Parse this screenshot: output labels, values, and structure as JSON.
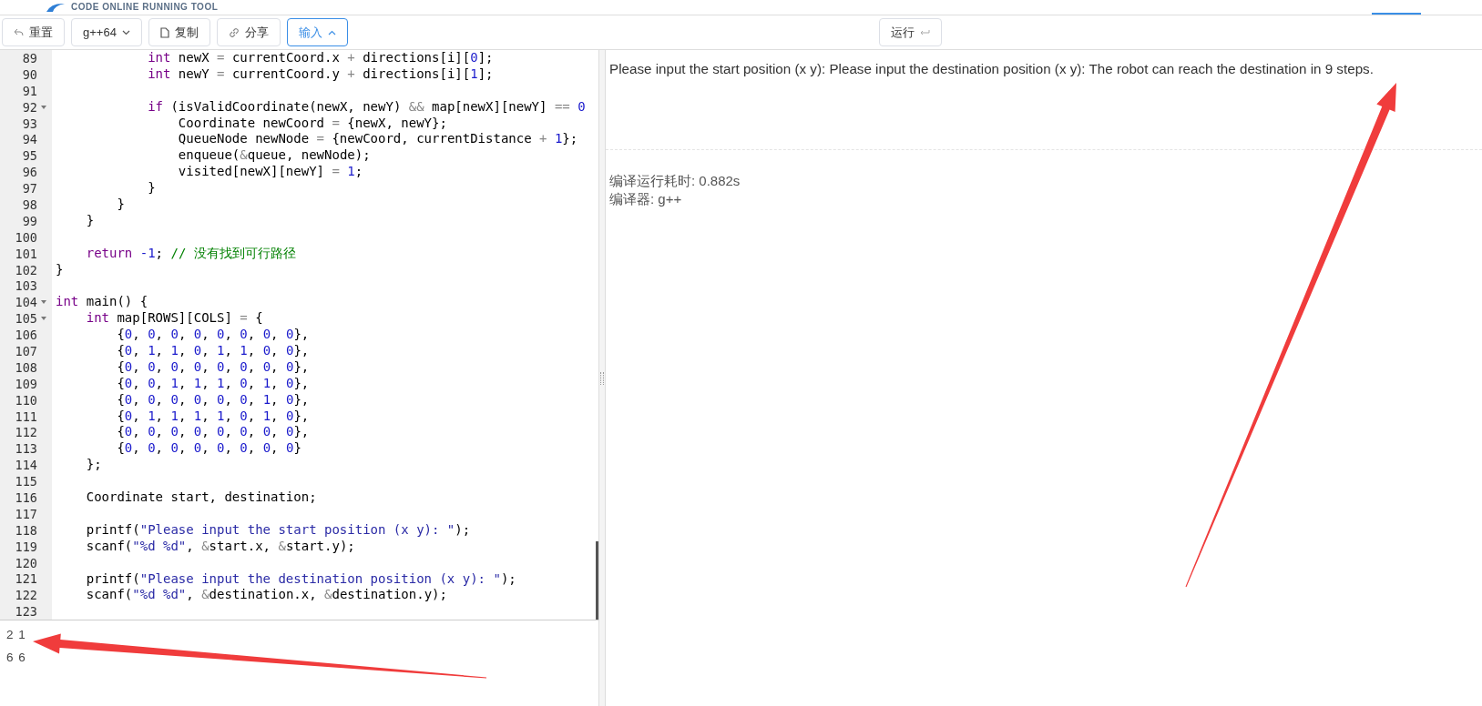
{
  "header": {
    "logo_text": "CODE ONLINE RUNNING TOOL"
  },
  "toolbar": {
    "buttons": [
      {
        "kind": "reset",
        "label": "重置",
        "selected": false
      },
      {
        "kind": "compiler",
        "label": "g++64",
        "selected": false
      },
      {
        "kind": "copy",
        "label": "复制",
        "selected": false
      },
      {
        "kind": "share",
        "label": "分享",
        "selected": false
      },
      {
        "kind": "input",
        "label": "输入",
        "selected": true
      }
    ],
    "run_button": {
      "label": "运行"
    }
  },
  "editor": {
    "lines": [
      {
        "number": "89",
        "fold": false,
        "tokens": [
          {
            "kind": "keyword",
            "text": "            int"
          },
          {
            "kind": "plain",
            "text": " newX "
          },
          {
            "kind": "operator",
            "text": "="
          },
          {
            "kind": "plain",
            "text": " currentCoord.x "
          },
          {
            "kind": "operator",
            "text": "+"
          },
          {
            "kind": "plain",
            "text": " directions[i]["
          },
          {
            "kind": "number",
            "text": "0"
          },
          {
            "kind": "plain",
            "text": "];"
          }
        ]
      },
      {
        "number": "90",
        "fold": false,
        "tokens": [
          {
            "kind": "keyword",
            "text": "            int"
          },
          {
            "kind": "plain",
            "text": " newY "
          },
          {
            "kind": "operator",
            "text": "="
          },
          {
            "kind": "plain",
            "text": " currentCoord.y "
          },
          {
            "kind": "operator",
            "text": "+"
          },
          {
            "kind": "plain",
            "text": " directions[i]["
          },
          {
            "kind": "number",
            "text": "1"
          },
          {
            "kind": "plain",
            "text": "];"
          }
        ]
      },
      {
        "number": "91",
        "fold": false
      },
      {
        "number": "92",
        "fold": true,
        "tokens": [
          {
            "kind": "keyword",
            "text": "            if"
          },
          {
            "kind": "plain",
            "text": " (isValidCoordinate(newX, newY) "
          },
          {
            "kind": "operator",
            "text": "&&"
          },
          {
            "kind": "plain",
            "text": " map[newX][newY] "
          },
          {
            "kind": "operator",
            "text": "== "
          },
          {
            "kind": "number",
            "text": "0"
          }
        ]
      },
      {
        "number": "93",
        "fold": false,
        "tokens": [
          {
            "kind": "plain",
            "text": "                Coordinate newCoord "
          },
          {
            "kind": "operator",
            "text": "="
          },
          {
            "kind": "plain",
            "text": " {newX, newY};"
          }
        ]
      },
      {
        "number": "94",
        "fold": false,
        "tokens": [
          {
            "kind": "plain",
            "text": "                QueueNode newNode "
          },
          {
            "kind": "operator",
            "text": "="
          },
          {
            "kind": "plain",
            "text": " {newCoord, currentDistance "
          },
          {
            "kind": "operator",
            "text": "+ "
          },
          {
            "kind": "number",
            "text": "1"
          },
          {
            "kind": "plain",
            "text": "};"
          }
        ]
      },
      {
        "number": "95",
        "fold": false,
        "tokens": [
          {
            "kind": "plain",
            "text": "                enqueue("
          },
          {
            "kind": "operator",
            "text": "&"
          },
          {
            "kind": "plain",
            "text": "queue, newNode);"
          }
        ]
      },
      {
        "number": "96",
        "fold": false,
        "tokens": [
          {
            "kind": "plain",
            "text": "                visited[newX][newY] "
          },
          {
            "kind": "operator",
            "text": "= "
          },
          {
            "kind": "number",
            "text": "1"
          },
          {
            "kind": "plain",
            "text": ";"
          }
        ]
      },
      {
        "number": "97",
        "fold": false,
        "tokens": [
          {
            "kind": "plain",
            "text": "            }"
          }
        ]
      },
      {
        "number": "98",
        "fold": false,
        "tokens": [
          {
            "kind": "plain",
            "text": "        }"
          }
        ]
      },
      {
        "number": "99",
        "fold": false,
        "tokens": [
          {
            "kind": "plain",
            "text": "    }"
          }
        ]
      },
      {
        "number": "100",
        "fold": false
      },
      {
        "number": "101",
        "fold": false,
        "tokens": [
          {
            "kind": "keyword",
            "text": "    return"
          },
          {
            "kind": "number",
            "text": " -1"
          },
          {
            "kind": "plain",
            "text": "; "
          },
          {
            "kind": "comment",
            "text": "// 没有找到可行路径"
          }
        ]
      },
      {
        "number": "102",
        "fold": false,
        "tokens": [
          {
            "kind": "plain",
            "text": "}"
          }
        ]
      },
      {
        "number": "103",
        "fold": false
      },
      {
        "number": "104",
        "fold": true,
        "tokens": [
          {
            "kind": "keyword",
            "text": "int"
          },
          {
            "kind": "plain",
            "text": " main() {"
          }
        ]
      },
      {
        "number": "105",
        "fold": true,
        "tokens": [
          {
            "kind": "keyword",
            "text": "    int"
          },
          {
            "kind": "plain",
            "text": " map[ROWS][COLS] "
          },
          {
            "kind": "operator",
            "text": "="
          },
          {
            "kind": "plain",
            "text": " {"
          }
        ]
      },
      {
        "number": "106",
        "fold": false,
        "tokens": [
          {
            "kind": "plain",
            "text": "        {"
          },
          {
            "kind": "number",
            "text": "0"
          },
          {
            "kind": "plain",
            "text": ", "
          },
          {
            "kind": "number",
            "text": "0"
          },
          {
            "kind": "plain",
            "text": ", "
          },
          {
            "kind": "number",
            "text": "0"
          },
          {
            "kind": "plain",
            "text": ", "
          },
          {
            "kind": "number",
            "text": "0"
          },
          {
            "kind": "plain",
            "text": ", "
          },
          {
            "kind": "number",
            "text": "0"
          },
          {
            "kind": "plain",
            "text": ", "
          },
          {
            "kind": "number",
            "text": "0"
          },
          {
            "kind": "plain",
            "text": ", "
          },
          {
            "kind": "number",
            "text": "0"
          },
          {
            "kind": "plain",
            "text": ", "
          },
          {
            "kind": "number",
            "text": "0"
          },
          {
            "kind": "plain",
            "text": "},"
          }
        ]
      },
      {
        "number": "107",
        "fold": false,
        "tokens": [
          {
            "kind": "plain",
            "text": "        {"
          },
          {
            "kind": "number",
            "text": "0"
          },
          {
            "kind": "plain",
            "text": ", "
          },
          {
            "kind": "number",
            "text": "1"
          },
          {
            "kind": "plain",
            "text": ", "
          },
          {
            "kind": "number",
            "text": "1"
          },
          {
            "kind": "plain",
            "text": ", "
          },
          {
            "kind": "number",
            "text": "0"
          },
          {
            "kind": "plain",
            "text": ", "
          },
          {
            "kind": "number",
            "text": "1"
          },
          {
            "kind": "plain",
            "text": ", "
          },
          {
            "kind": "number",
            "text": "1"
          },
          {
            "kind": "plain",
            "text": ", "
          },
          {
            "kind": "number",
            "text": "0"
          },
          {
            "kind": "plain",
            "text": ", "
          },
          {
            "kind": "number",
            "text": "0"
          },
          {
            "kind": "plain",
            "text": "},"
          }
        ]
      },
      {
        "number": "108",
        "fold": false,
        "tokens": [
          {
            "kind": "plain",
            "text": "        {"
          },
          {
            "kind": "number",
            "text": "0"
          },
          {
            "kind": "plain",
            "text": ", "
          },
          {
            "kind": "number",
            "text": "0"
          },
          {
            "kind": "plain",
            "text": ", "
          },
          {
            "kind": "number",
            "text": "0"
          },
          {
            "kind": "plain",
            "text": ", "
          },
          {
            "kind": "number",
            "text": "0"
          },
          {
            "kind": "plain",
            "text": ", "
          },
          {
            "kind": "number",
            "text": "0"
          },
          {
            "kind": "plain",
            "text": ", "
          },
          {
            "kind": "number",
            "text": "0"
          },
          {
            "kind": "plain",
            "text": ", "
          },
          {
            "kind": "number",
            "text": "0"
          },
          {
            "kind": "plain",
            "text": ", "
          },
          {
            "kind": "number",
            "text": "0"
          },
          {
            "kind": "plain",
            "text": "},"
          }
        ]
      },
      {
        "number": "109",
        "fold": false,
        "tokens": [
          {
            "kind": "plain",
            "text": "        {"
          },
          {
            "kind": "number",
            "text": "0"
          },
          {
            "kind": "plain",
            "text": ", "
          },
          {
            "kind": "number",
            "text": "0"
          },
          {
            "kind": "plain",
            "text": ", "
          },
          {
            "kind": "number",
            "text": "1"
          },
          {
            "kind": "plain",
            "text": ", "
          },
          {
            "kind": "number",
            "text": "1"
          },
          {
            "kind": "plain",
            "text": ", "
          },
          {
            "kind": "number",
            "text": "1"
          },
          {
            "kind": "plain",
            "text": ", "
          },
          {
            "kind": "number",
            "text": "0"
          },
          {
            "kind": "plain",
            "text": ", "
          },
          {
            "kind": "number",
            "text": "1"
          },
          {
            "kind": "plain",
            "text": ", "
          },
          {
            "kind": "number",
            "text": "0"
          },
          {
            "kind": "plain",
            "text": "},"
          }
        ]
      },
      {
        "number": "110",
        "fold": false,
        "tokens": [
          {
            "kind": "plain",
            "text": "        {"
          },
          {
            "kind": "number",
            "text": "0"
          },
          {
            "kind": "plain",
            "text": ", "
          },
          {
            "kind": "number",
            "text": "0"
          },
          {
            "kind": "plain",
            "text": ", "
          },
          {
            "kind": "number",
            "text": "0"
          },
          {
            "kind": "plain",
            "text": ", "
          },
          {
            "kind": "number",
            "text": "0"
          },
          {
            "kind": "plain",
            "text": ", "
          },
          {
            "kind": "number",
            "text": "0"
          },
          {
            "kind": "plain",
            "text": ", "
          },
          {
            "kind": "number",
            "text": "0"
          },
          {
            "kind": "plain",
            "text": ", "
          },
          {
            "kind": "number",
            "text": "1"
          },
          {
            "kind": "plain",
            "text": ", "
          },
          {
            "kind": "number",
            "text": "0"
          },
          {
            "kind": "plain",
            "text": "},"
          }
        ]
      },
      {
        "number": "111",
        "fold": false,
        "tokens": [
          {
            "kind": "plain",
            "text": "        {"
          },
          {
            "kind": "number",
            "text": "0"
          },
          {
            "kind": "plain",
            "text": ", "
          },
          {
            "kind": "number",
            "text": "1"
          },
          {
            "kind": "plain",
            "text": ", "
          },
          {
            "kind": "number",
            "text": "1"
          },
          {
            "kind": "plain",
            "text": ", "
          },
          {
            "kind": "number",
            "text": "1"
          },
          {
            "kind": "plain",
            "text": ", "
          },
          {
            "kind": "number",
            "text": "1"
          },
          {
            "kind": "plain",
            "text": ", "
          },
          {
            "kind": "number",
            "text": "0"
          },
          {
            "kind": "plain",
            "text": ", "
          },
          {
            "kind": "number",
            "text": "1"
          },
          {
            "kind": "plain",
            "text": ", "
          },
          {
            "kind": "number",
            "text": "0"
          },
          {
            "kind": "plain",
            "text": "},"
          }
        ]
      },
      {
        "number": "112",
        "fold": false,
        "tokens": [
          {
            "kind": "plain",
            "text": "        {"
          },
          {
            "kind": "number",
            "text": "0"
          },
          {
            "kind": "plain",
            "text": ", "
          },
          {
            "kind": "number",
            "text": "0"
          },
          {
            "kind": "plain",
            "text": ", "
          },
          {
            "kind": "number",
            "text": "0"
          },
          {
            "kind": "plain",
            "text": ", "
          },
          {
            "kind": "number",
            "text": "0"
          },
          {
            "kind": "plain",
            "text": ", "
          },
          {
            "kind": "number",
            "text": "0"
          },
          {
            "kind": "plain",
            "text": ", "
          },
          {
            "kind": "number",
            "text": "0"
          },
          {
            "kind": "plain",
            "text": ", "
          },
          {
            "kind": "number",
            "text": "0"
          },
          {
            "kind": "plain",
            "text": ", "
          },
          {
            "kind": "number",
            "text": "0"
          },
          {
            "kind": "plain",
            "text": "},"
          }
        ]
      },
      {
        "number": "113",
        "fold": false,
        "tokens": [
          {
            "kind": "plain",
            "text": "        {"
          },
          {
            "kind": "number",
            "text": "0"
          },
          {
            "kind": "plain",
            "text": ", "
          },
          {
            "kind": "number",
            "text": "0"
          },
          {
            "kind": "plain",
            "text": ", "
          },
          {
            "kind": "number",
            "text": "0"
          },
          {
            "kind": "plain",
            "text": ", "
          },
          {
            "kind": "number",
            "text": "0"
          },
          {
            "kind": "plain",
            "text": ", "
          },
          {
            "kind": "number",
            "text": "0"
          },
          {
            "kind": "plain",
            "text": ", "
          },
          {
            "kind": "number",
            "text": "0"
          },
          {
            "kind": "plain",
            "text": ", "
          },
          {
            "kind": "number",
            "text": "0"
          },
          {
            "kind": "plain",
            "text": ", "
          },
          {
            "kind": "number",
            "text": "0"
          },
          {
            "kind": "plain",
            "text": "}"
          }
        ]
      },
      {
        "number": "114",
        "fold": false,
        "tokens": [
          {
            "kind": "plain",
            "text": "    };"
          }
        ]
      },
      {
        "number": "115",
        "fold": false
      },
      {
        "number": "116",
        "fold": false,
        "tokens": [
          {
            "kind": "plain",
            "text": "    Coordinate start, destination;"
          }
        ]
      },
      {
        "number": "117",
        "fold": false
      },
      {
        "number": "118",
        "fold": false,
        "tokens": [
          {
            "kind": "plain",
            "text": "    printf("
          },
          {
            "kind": "string",
            "text": "\"Please input the start position (x y): \""
          },
          {
            "kind": "plain",
            "text": ");"
          }
        ]
      },
      {
        "number": "119",
        "fold": false,
        "tokens": [
          {
            "kind": "plain",
            "text": "    scanf("
          },
          {
            "kind": "string",
            "text": "\"%d %d\""
          },
          {
            "kind": "plain",
            "text": ", "
          },
          {
            "kind": "operator",
            "text": "&"
          },
          {
            "kind": "plain",
            "text": "start.x, "
          },
          {
            "kind": "operator",
            "text": "&"
          },
          {
            "kind": "plain",
            "text": "start.y);"
          }
        ]
      },
      {
        "number": "120",
        "fold": false
      },
      {
        "number": "121",
        "fold": false,
        "tokens": [
          {
            "kind": "plain",
            "text": "    printf("
          },
          {
            "kind": "string",
            "text": "\"Please input the destination position (x y): \""
          },
          {
            "kind": "plain",
            "text": ");"
          }
        ]
      },
      {
        "number": "122",
        "fold": false,
        "tokens": [
          {
            "kind": "plain",
            "text": "    scanf("
          },
          {
            "kind": "string",
            "text": "\"%d %d\""
          },
          {
            "kind": "plain",
            "text": ", "
          },
          {
            "kind": "operator",
            "text": "&"
          },
          {
            "kind": "plain",
            "text": "destination.x, "
          },
          {
            "kind": "operator",
            "text": "&"
          },
          {
            "kind": "plain",
            "text": "destination.y);"
          }
        ]
      },
      {
        "number": "123",
        "fold": false
      }
    ]
  },
  "input": {
    "lines": [
      "2 1",
      "6 6"
    ]
  },
  "output": {
    "text": "Please input the start position (x y): Please input the destination position (x y): The robot can reach the destination in 9 steps.",
    "info": [
      "编译运行耗时: 0.882s",
      "编译器: g++"
    ]
  }
}
